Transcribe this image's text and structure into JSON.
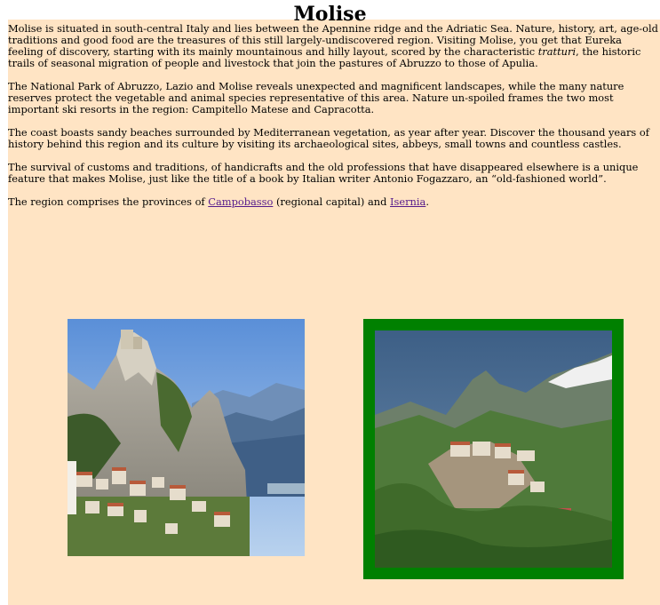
{
  "page": {
    "title": "Molise"
  },
  "paragraphs": {
    "p1_before": "Molise is situated in south-central Italy and lies between the Apennine ridge and the Adriatic Sea. Nature, history, art, age-old traditions and good food are the treasures of this still largely-undiscovered region. Visiting Molise, you get that Eureka feeling of discovery, starting with its mainly mountainous and hilly layout, scored by the characteristic ",
    "p1_italic": "tratturi",
    "p1_after": ", the historic trails of seasonal migration of people and livestock that join the pastures of Abruzzo to those of Apulia.",
    "p2": "The National Park of Abruzzo, Lazio and Molise reveals unexpected and magnificent landscapes, while the many nature reserves protect the vegetable and animal species representative of this area. Nature un-spoiled frames the two most important ski resorts in the region: Campitello Matese and Capracotta.",
    "p3": "The coast boasts sandy beaches surrounded by Mediterranean vegetation, as year after year. Discover the thousand years of history behind this region and its culture by visiting its archaeological sites, abbeys, small towns and countless castles.",
    "p4": "The survival of customs and traditions, of handicrafts and the old professions that have disappeared elsewhere is a unique feature that makes Molise, just like the title of a book by Italian writer Antonio Fogazzaro, an “old-fashioned world”.",
    "p5_before": "The region comprises the provinces of ",
    "p5_link1": "Campobasso",
    "p5_middle": " (regional capital) and ",
    "p5_link2": "Isernia",
    "p5_after": "."
  },
  "colors": {
    "panel_background": "#ffe4c4",
    "link_visited": "#551a8b",
    "image_frame": "#008000"
  }
}
